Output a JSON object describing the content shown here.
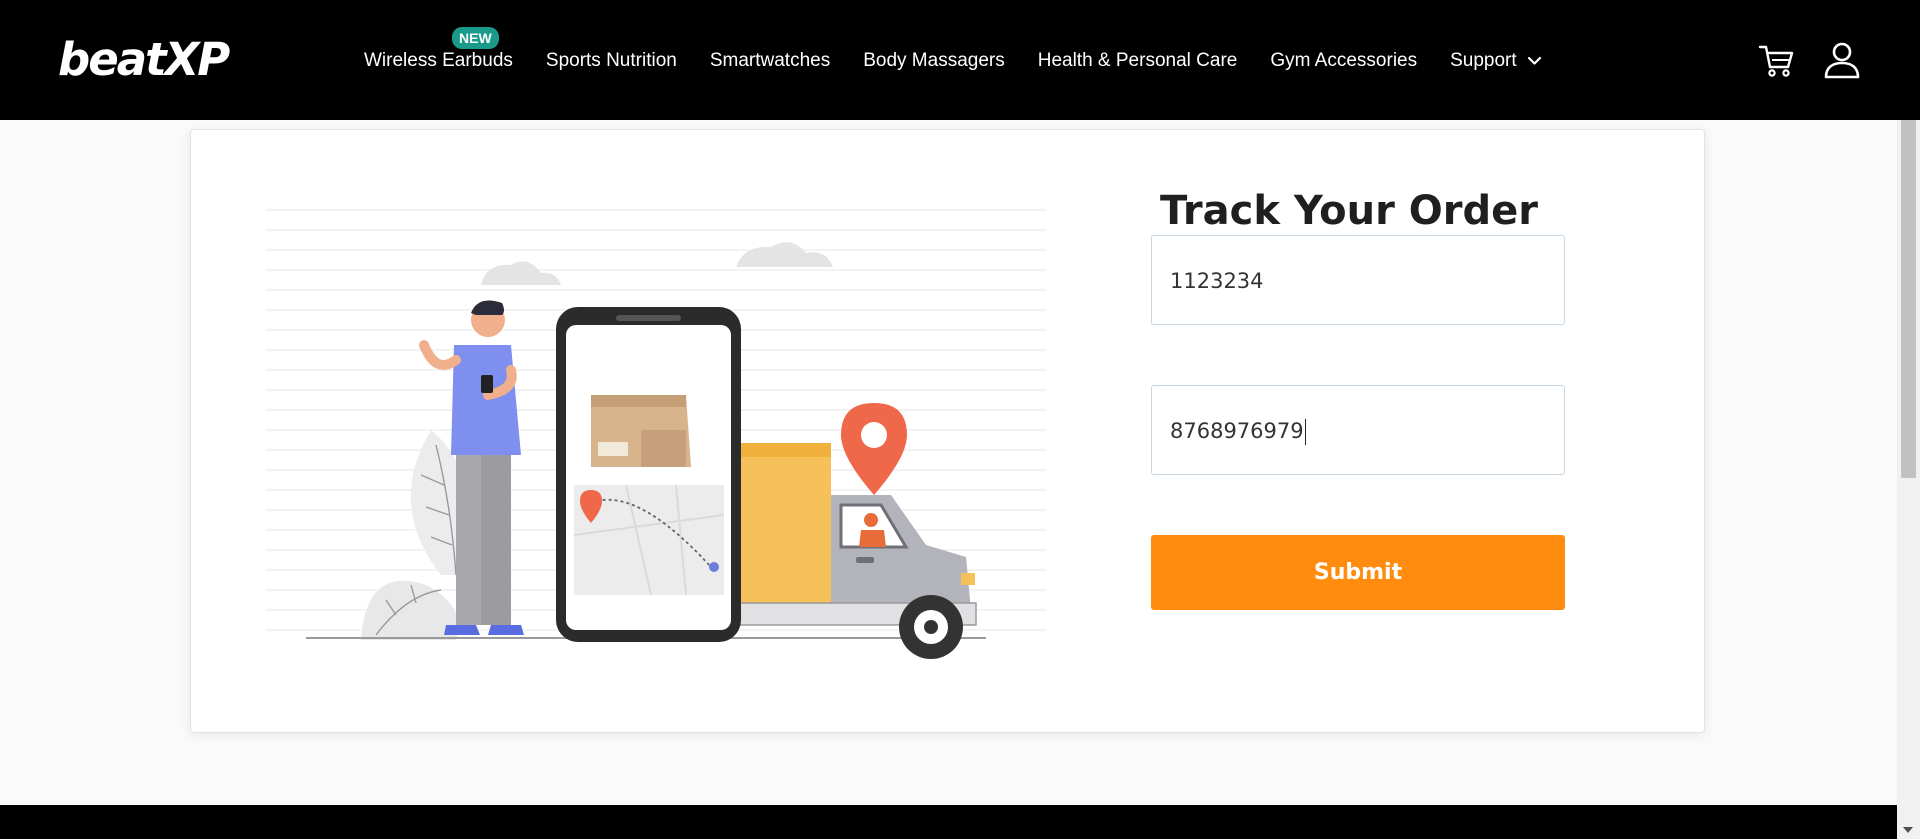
{
  "header": {
    "logo_text": "beatXP",
    "nav": [
      {
        "label": "Wireless Earbuds",
        "badge": "NEW"
      },
      {
        "label": "Sports Nutrition"
      },
      {
        "label": "Smartwatches"
      },
      {
        "label": "Body Massagers"
      },
      {
        "label": "Health & Personal Care"
      },
      {
        "label": "Gym Accessories"
      },
      {
        "label": "Support"
      }
    ],
    "icons": {
      "cart": "cart-icon",
      "user": "user-icon",
      "support_dropdown": "chevron-down-icon"
    }
  },
  "track_form": {
    "title": "Track Your Order",
    "order_id_value": "1123234",
    "phone_value": "8768976979",
    "submit_label": "Submit"
  },
  "colors": {
    "header_bg": "#000000",
    "accent_orange": "#ff8c0f",
    "badge_teal": "#1a9a8a",
    "logo_accent": "#11b4a2"
  }
}
